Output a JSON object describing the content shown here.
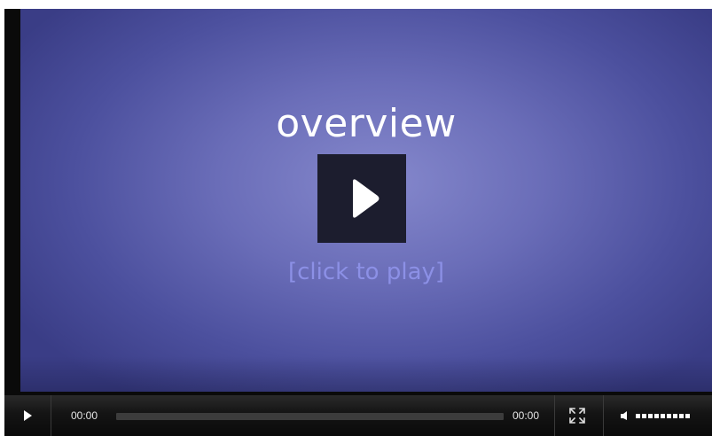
{
  "video": {
    "title": "overview",
    "click_text": "[click to play]"
  },
  "controls": {
    "current_time": "00:00",
    "duration": "00:00",
    "progress": 0,
    "volume_level": 1.0
  },
  "icons": {
    "big_play": "play-icon",
    "small_play": "play-icon",
    "fullscreen": "fullscreen-icon",
    "volume": "speaker-icon"
  },
  "colors": {
    "video_center": "#8588cc",
    "video_edge": "#3a3d86",
    "click_text": "#8c90e6",
    "play_button_bg": "#1c1d2e",
    "control_bar": "#141414"
  }
}
